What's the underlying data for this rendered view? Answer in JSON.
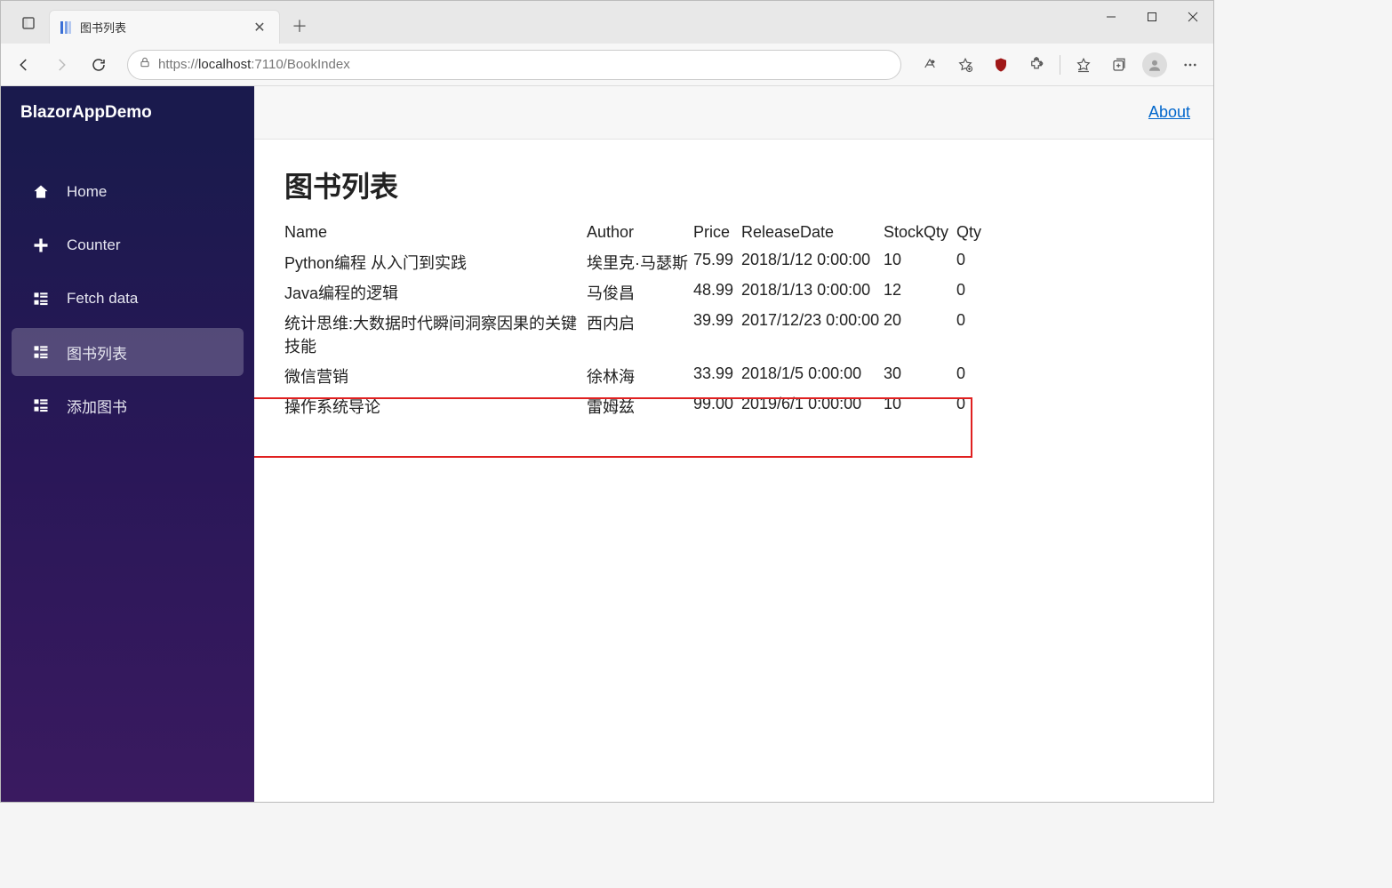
{
  "browser": {
    "tab_title": "图书列表",
    "url_prefix": "https://",
    "url_host": "localhost",
    "url_port_path": ":7110/BookIndex"
  },
  "app": {
    "brand": "BlazorAppDemo",
    "about": "About"
  },
  "sidebar": {
    "items": [
      {
        "label": "Home"
      },
      {
        "label": "Counter"
      },
      {
        "label": "Fetch data"
      },
      {
        "label": "图书列表"
      },
      {
        "label": "添加图书"
      }
    ]
  },
  "page": {
    "heading": "图书列表",
    "columns": {
      "name": "Name",
      "author": "Author",
      "price": "Price",
      "releaseDate": "ReleaseDate",
      "stockQty": "StockQty",
      "qty": "Qty"
    },
    "rows": [
      {
        "name": "Python编程 从入门到实践",
        "author": "埃里克·马瑟斯",
        "price": "75.99",
        "releaseDate": "2018/1/12 0:00:00",
        "stockQty": "10",
        "qty": "0"
      },
      {
        "name": "Java编程的逻辑",
        "author": "马俊昌",
        "price": "48.99",
        "releaseDate": "2018/1/13 0:00:00",
        "stockQty": "12",
        "qty": "0"
      },
      {
        "name": "统计思维:大数据时代瞬间洞察因果的关键技能",
        "author": "西内启",
        "price": "39.99",
        "releaseDate": "2017/12/23 0:00:00",
        "stockQty": "20",
        "qty": "0"
      },
      {
        "name": "微信营销",
        "author": "徐林海",
        "price": "33.99",
        "releaseDate": "2018/1/5 0:00:00",
        "stockQty": "30",
        "qty": "0"
      },
      {
        "name": "操作系统导论",
        "author": "雷姆兹",
        "price": "99.00",
        "releaseDate": "2019/6/1 0:00:00",
        "stockQty": "10",
        "qty": "0"
      }
    ]
  }
}
